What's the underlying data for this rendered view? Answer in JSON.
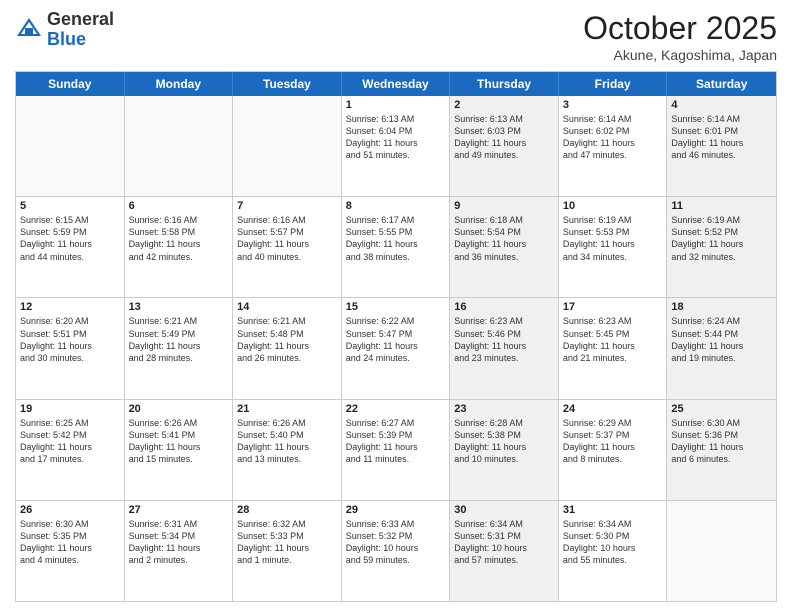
{
  "header": {
    "logo_general": "General",
    "logo_blue": "Blue",
    "month_title": "October 2025",
    "location": "Akune, Kagoshima, Japan"
  },
  "days_of_week": [
    "Sunday",
    "Monday",
    "Tuesday",
    "Wednesday",
    "Thursday",
    "Friday",
    "Saturday"
  ],
  "weeks": [
    [
      {
        "day": "",
        "info": "",
        "shaded": false,
        "empty": true
      },
      {
        "day": "",
        "info": "",
        "shaded": false,
        "empty": true
      },
      {
        "day": "",
        "info": "",
        "shaded": false,
        "empty": true
      },
      {
        "day": "1",
        "info": "Sunrise: 6:13 AM\nSunset: 6:04 PM\nDaylight: 11 hours\nand 51 minutes.",
        "shaded": false,
        "empty": false
      },
      {
        "day": "2",
        "info": "Sunrise: 6:13 AM\nSunset: 6:03 PM\nDaylight: 11 hours\nand 49 minutes.",
        "shaded": true,
        "empty": false
      },
      {
        "day": "3",
        "info": "Sunrise: 6:14 AM\nSunset: 6:02 PM\nDaylight: 11 hours\nand 47 minutes.",
        "shaded": false,
        "empty": false
      },
      {
        "day": "4",
        "info": "Sunrise: 6:14 AM\nSunset: 6:01 PM\nDaylight: 11 hours\nand 46 minutes.",
        "shaded": true,
        "empty": false
      }
    ],
    [
      {
        "day": "5",
        "info": "Sunrise: 6:15 AM\nSunset: 5:59 PM\nDaylight: 11 hours\nand 44 minutes.",
        "shaded": false,
        "empty": false
      },
      {
        "day": "6",
        "info": "Sunrise: 6:16 AM\nSunset: 5:58 PM\nDaylight: 11 hours\nand 42 minutes.",
        "shaded": false,
        "empty": false
      },
      {
        "day": "7",
        "info": "Sunrise: 6:16 AM\nSunset: 5:57 PM\nDaylight: 11 hours\nand 40 minutes.",
        "shaded": false,
        "empty": false
      },
      {
        "day": "8",
        "info": "Sunrise: 6:17 AM\nSunset: 5:55 PM\nDaylight: 11 hours\nand 38 minutes.",
        "shaded": false,
        "empty": false
      },
      {
        "day": "9",
        "info": "Sunrise: 6:18 AM\nSunset: 5:54 PM\nDaylight: 11 hours\nand 36 minutes.",
        "shaded": true,
        "empty": false
      },
      {
        "day": "10",
        "info": "Sunrise: 6:19 AM\nSunset: 5:53 PM\nDaylight: 11 hours\nand 34 minutes.",
        "shaded": false,
        "empty": false
      },
      {
        "day": "11",
        "info": "Sunrise: 6:19 AM\nSunset: 5:52 PM\nDaylight: 11 hours\nand 32 minutes.",
        "shaded": true,
        "empty": false
      }
    ],
    [
      {
        "day": "12",
        "info": "Sunrise: 6:20 AM\nSunset: 5:51 PM\nDaylight: 11 hours\nand 30 minutes.",
        "shaded": false,
        "empty": false
      },
      {
        "day": "13",
        "info": "Sunrise: 6:21 AM\nSunset: 5:49 PM\nDaylight: 11 hours\nand 28 minutes.",
        "shaded": false,
        "empty": false
      },
      {
        "day": "14",
        "info": "Sunrise: 6:21 AM\nSunset: 5:48 PM\nDaylight: 11 hours\nand 26 minutes.",
        "shaded": false,
        "empty": false
      },
      {
        "day": "15",
        "info": "Sunrise: 6:22 AM\nSunset: 5:47 PM\nDaylight: 11 hours\nand 24 minutes.",
        "shaded": false,
        "empty": false
      },
      {
        "day": "16",
        "info": "Sunrise: 6:23 AM\nSunset: 5:46 PM\nDaylight: 11 hours\nand 23 minutes.",
        "shaded": true,
        "empty": false
      },
      {
        "day": "17",
        "info": "Sunrise: 6:23 AM\nSunset: 5:45 PM\nDaylight: 11 hours\nand 21 minutes.",
        "shaded": false,
        "empty": false
      },
      {
        "day": "18",
        "info": "Sunrise: 6:24 AM\nSunset: 5:44 PM\nDaylight: 11 hours\nand 19 minutes.",
        "shaded": true,
        "empty": false
      }
    ],
    [
      {
        "day": "19",
        "info": "Sunrise: 6:25 AM\nSunset: 5:42 PM\nDaylight: 11 hours\nand 17 minutes.",
        "shaded": false,
        "empty": false
      },
      {
        "day": "20",
        "info": "Sunrise: 6:26 AM\nSunset: 5:41 PM\nDaylight: 11 hours\nand 15 minutes.",
        "shaded": false,
        "empty": false
      },
      {
        "day": "21",
        "info": "Sunrise: 6:26 AM\nSunset: 5:40 PM\nDaylight: 11 hours\nand 13 minutes.",
        "shaded": false,
        "empty": false
      },
      {
        "day": "22",
        "info": "Sunrise: 6:27 AM\nSunset: 5:39 PM\nDaylight: 11 hours\nand 11 minutes.",
        "shaded": false,
        "empty": false
      },
      {
        "day": "23",
        "info": "Sunrise: 6:28 AM\nSunset: 5:38 PM\nDaylight: 11 hours\nand 10 minutes.",
        "shaded": true,
        "empty": false
      },
      {
        "day": "24",
        "info": "Sunrise: 6:29 AM\nSunset: 5:37 PM\nDaylight: 11 hours\nand 8 minutes.",
        "shaded": false,
        "empty": false
      },
      {
        "day": "25",
        "info": "Sunrise: 6:30 AM\nSunset: 5:36 PM\nDaylight: 11 hours\nand 6 minutes.",
        "shaded": true,
        "empty": false
      }
    ],
    [
      {
        "day": "26",
        "info": "Sunrise: 6:30 AM\nSunset: 5:35 PM\nDaylight: 11 hours\nand 4 minutes.",
        "shaded": false,
        "empty": false
      },
      {
        "day": "27",
        "info": "Sunrise: 6:31 AM\nSunset: 5:34 PM\nDaylight: 11 hours\nand 2 minutes.",
        "shaded": false,
        "empty": false
      },
      {
        "day": "28",
        "info": "Sunrise: 6:32 AM\nSunset: 5:33 PM\nDaylight: 11 hours\nand 1 minute.",
        "shaded": false,
        "empty": false
      },
      {
        "day": "29",
        "info": "Sunrise: 6:33 AM\nSunset: 5:32 PM\nDaylight: 10 hours\nand 59 minutes.",
        "shaded": false,
        "empty": false
      },
      {
        "day": "30",
        "info": "Sunrise: 6:34 AM\nSunset: 5:31 PM\nDaylight: 10 hours\nand 57 minutes.",
        "shaded": true,
        "empty": false
      },
      {
        "day": "31",
        "info": "Sunrise: 6:34 AM\nSunset: 5:30 PM\nDaylight: 10 hours\nand 55 minutes.",
        "shaded": false,
        "empty": false
      },
      {
        "day": "",
        "info": "",
        "shaded": false,
        "empty": true
      }
    ]
  ]
}
